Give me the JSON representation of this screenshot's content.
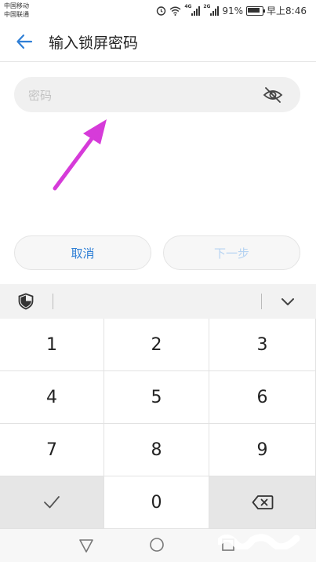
{
  "status_bar": {
    "carrier_1": "中国移动",
    "carrier_2": "中国联通",
    "signal_1_tag": "4G",
    "signal_2_tag": "2G",
    "battery": "91%",
    "time": "早上8:46"
  },
  "header": {
    "title": "输入锁屏密码",
    "back_icon": "arrow-left-icon"
  },
  "password_field": {
    "placeholder": "密码",
    "value": "",
    "visibility_icon": "eye-off-icon"
  },
  "buttons": {
    "cancel": "取消",
    "next": "下一步"
  },
  "keyboard": {
    "shield_icon": "shield-icon",
    "collapse_icon": "chevron-down-icon",
    "keys": [
      "1",
      "2",
      "3",
      "4",
      "5",
      "6",
      "7",
      "8",
      "9",
      "✓",
      "0",
      "⌫"
    ]
  },
  "colors": {
    "accent": "#2f7fd6",
    "disabled_text": "#b6d3f2",
    "annotation_arrow": "#d63bd9"
  }
}
